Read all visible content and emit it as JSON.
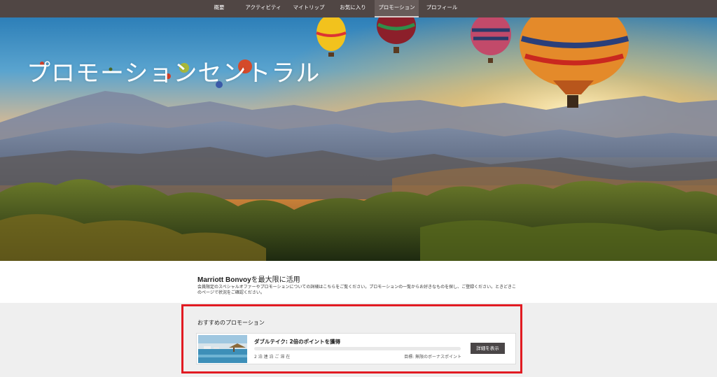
{
  "nav": {
    "items": [
      {
        "label": "概要",
        "active": false
      },
      {
        "label": "アクティビティ",
        "active": false
      },
      {
        "label": "マイトリップ",
        "active": false
      },
      {
        "label": "お気に入り",
        "active": false
      },
      {
        "label": "プロモーション",
        "active": true
      },
      {
        "label": "プロフィール",
        "active": false
      }
    ]
  },
  "hero": {
    "title": "プロモーションセントラル"
  },
  "intro": {
    "brand": "Marriott Bonvoy",
    "title_suffix": "を最大限に活用",
    "text": "会員限定のスペシャルオファーやプロモーションについての詳細はこちらをご覧ください。プロモーションの一覧からお好きなものを探し、ご登録ください。ときどきこのページで状況をご確認ください。"
  },
  "recommended": {
    "heading": "おすすめのプロモーション",
    "promotion": {
      "title": "ダブルテイク: 2倍のポイントを獲得",
      "stays": "2 泊 連 泊 ご 滞 在",
      "goal": "目標: 無限のボーナスポイント",
      "button": "詳細を表示",
      "progress": 0
    }
  },
  "colors": {
    "nav_bg": "#504644",
    "highlight_border": "#e11b22",
    "button_bg": "#4a4647"
  }
}
